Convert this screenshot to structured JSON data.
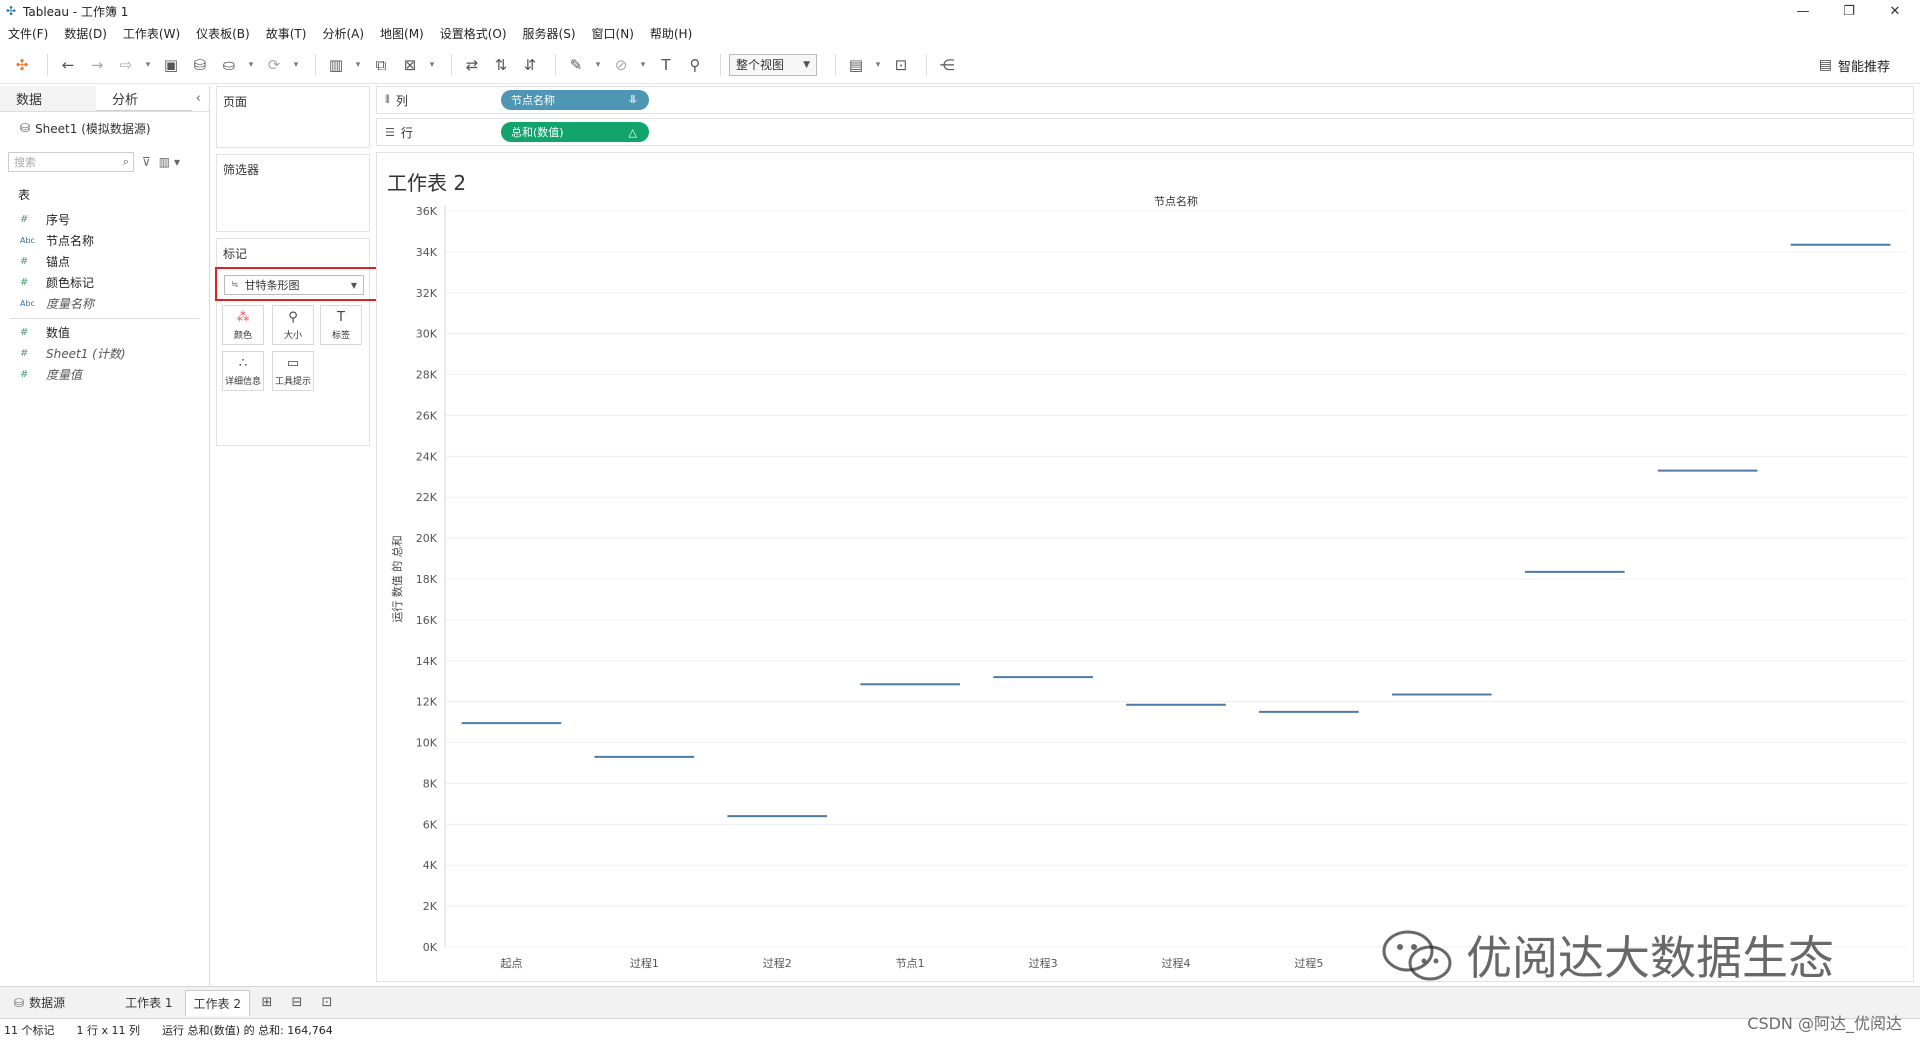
{
  "window": {
    "title": "Tableau - 工作簿 1"
  },
  "menu": [
    "文件(F)",
    "数据(D)",
    "工作表(W)",
    "仪表板(B)",
    "故事(T)",
    "分析(A)",
    "地图(M)",
    "设置格式(O)",
    "服务器(S)",
    "窗口(N)",
    "帮助(H)"
  ],
  "toolbar": {
    "view_select": "整个视图",
    "smart_label": "智能推荐"
  },
  "left": {
    "tab_data": "数据",
    "tab_analysis": "分析",
    "datasource": "Sheet1 (模拟数据源)",
    "search_placeholder": "搜索",
    "section": "表",
    "fields": [
      {
        "type": "#",
        "name": "序号"
      },
      {
        "type": "Abc",
        "name": "节点名称"
      },
      {
        "type": "#",
        "name": "锚点"
      },
      {
        "type": "#",
        "name": "颜色标记"
      },
      {
        "type": "Abc",
        "name": "度量名称"
      }
    ],
    "measures": [
      {
        "type": "#",
        "name": "数值"
      },
      {
        "type": "#",
        "name": "Sheet1 (计数)"
      },
      {
        "type": "#",
        "name": "度量值"
      }
    ]
  },
  "cards": {
    "pages": "页面",
    "filters": "筛选器",
    "marks": "标记",
    "mark_type": "甘特条形图",
    "mark_buttons": [
      "颜色",
      "大小",
      "标签",
      "详细信息",
      "工具提示"
    ]
  },
  "shelves": {
    "columns_label": "列",
    "rows_label": "行",
    "columns_pill": "节点名称",
    "rows_pill": "总和(数值)"
  },
  "sheet": {
    "title": "工作表 2",
    "header": "节点名称"
  },
  "chart_data": {
    "type": "gantt",
    "title": "工作表 2",
    "xlabel": "节点名称",
    "ylabel": "运行 数值 的 总和",
    "ylim": [
      0,
      36000
    ],
    "yticks": [
      "0K",
      "2K",
      "4K",
      "6K",
      "8K",
      "10K",
      "12K",
      "14K",
      "16K",
      "18K",
      "20K",
      "22K",
      "24K",
      "26K",
      "28K",
      "30K",
      "32K",
      "34K",
      "36K"
    ],
    "categories": [
      "起点",
      "过程1",
      "过程2",
      "节点1",
      "过程3",
      "过程4",
      "过程5",
      "",
      "",
      "",
      ""
    ],
    "values": [
      10950,
      9300,
      6400,
      12850,
      13200,
      11850,
      11500,
      12350,
      18350,
      23300,
      34350
    ],
    "mark_color": "#4e79a7",
    "grid": true
  },
  "bottom": {
    "datasource_tab": "数据源",
    "sheets": [
      "工作表 1",
      "工作表 2"
    ]
  },
  "status": {
    "marks": "11 个标记",
    "dims": "1 行 x 11 列",
    "sum": "运行 总和(数值) 的 总和: 164,764"
  },
  "watermark": {
    "text": "优阅达大数据生态",
    "csdn": "CSDN @阿达_优阅达"
  }
}
